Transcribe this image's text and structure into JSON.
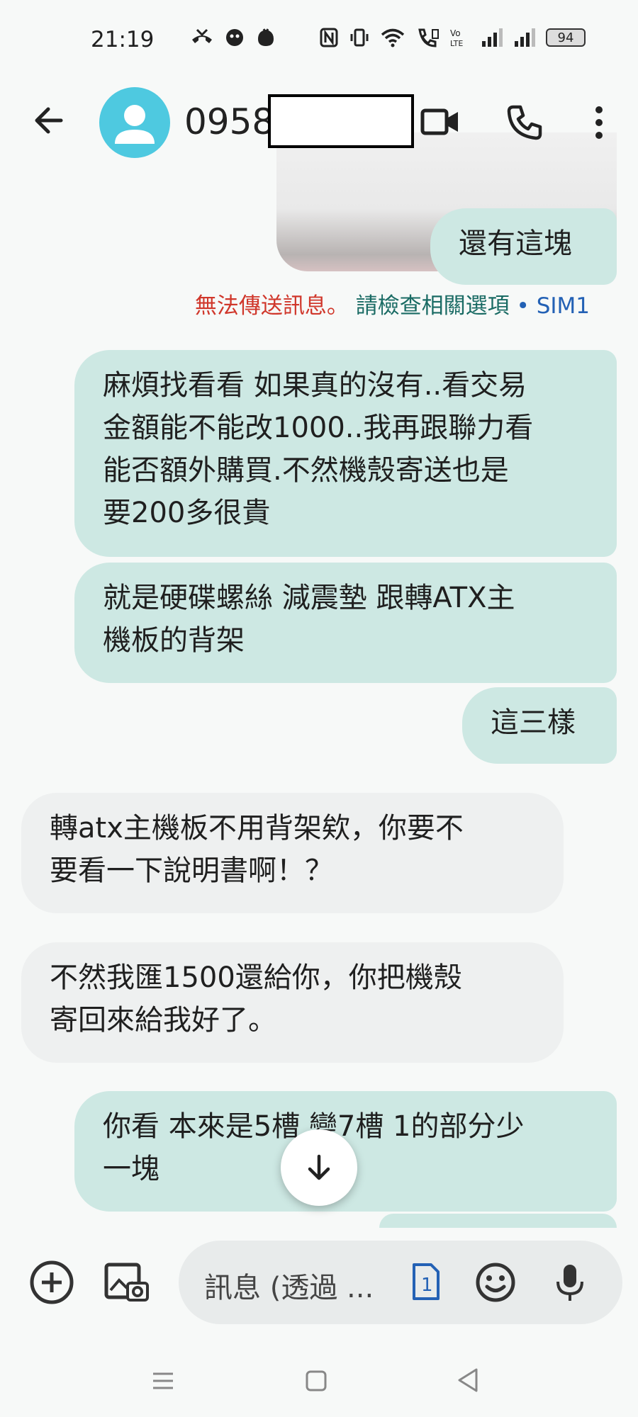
{
  "status_bar": {
    "time": "21:19",
    "battery": "94"
  },
  "header": {
    "contact_partial": "0958"
  },
  "messages": [
    {
      "direction": "sent",
      "text": "還有這塊"
    },
    {
      "direction": "sent",
      "text": "麻煩找看看 如果真的沒有..看交易\n金額能不能改1000..我再跟聯力看\n能否額外購買.不然機殼寄送也是\n要200多很貴"
    },
    {
      "direction": "sent",
      "text": "就是硬碟螺絲 減震墊 跟轉ATX主\n機板的背架"
    },
    {
      "direction": "sent",
      "text": "這三樣"
    },
    {
      "direction": "received",
      "text": "轉atx主機板不用背架欸，你要不\n要看一下說明書啊！？"
    },
    {
      "direction": "received",
      "text": "不然我匯1500還給你，你把機殼\n寄回來給我好了。"
    },
    {
      "direction": "sent",
      "text": "你看 本來是5槽 變7槽 1的部分少\n一塊"
    }
  ],
  "send_status": {
    "error": "無法傳送訊息。",
    "hint": "請檢查相關選項",
    "separator": "•",
    "sim": "SIM1"
  },
  "compose": {
    "placeholder": "訊息 (透過 ...",
    "sim_badge": "1"
  },
  "colors": {
    "sent_bubble": "#cde8e3",
    "received_bubble": "#eef0f0",
    "avatar": "#4ec9e0",
    "error_red": "#d0372b",
    "hint_teal": "#1a6b64",
    "sim_blue": "#2361b5"
  }
}
